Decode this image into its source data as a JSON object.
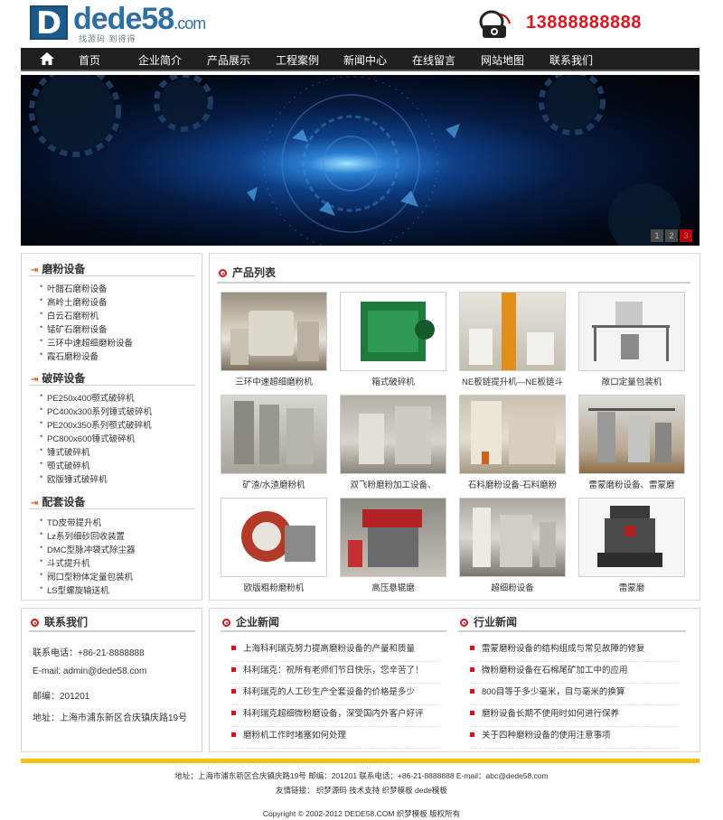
{
  "header": {
    "logo_text": "dede58",
    "logo_suffix": ".com",
    "logo_slogan": "找源码 到得得",
    "phone": "13888888888"
  },
  "nav": [
    "首页",
    "企业简介",
    "产品展示",
    "工程案例",
    "新闻中心",
    "在线留言",
    "网站地图",
    "联系我们"
  ],
  "slider": {
    "pages": [
      "1",
      "2",
      "3"
    ],
    "active": 3
  },
  "categories": [
    {
      "title": "磨粉设备",
      "items": [
        "叶腊石磨粉设备",
        "高岭土磨粉设备",
        "白云石磨粉机",
        "锰矿石磨粉设备",
        "三环中速超细磨粉设备",
        "霞石磨粉设备"
      ]
    },
    {
      "title": "破碎设备",
      "items": [
        "PE250x400颚式破碎机",
        "PC400x300系列锤式破碎机",
        "PE200x350系列颚式破碎机",
        "PC800x600锤式破碎机",
        "锤式破碎机",
        "颚式破碎机",
        "欧版锤式破碎机"
      ]
    },
    {
      "title": "配套设备",
      "items": [
        "TD皮带提升机",
        "Lz系列细砂回收装置",
        "DMC型脉冲袋式除尘器",
        "斗式提升机",
        "阀口型粉体定量包装机",
        "LS型螺旋输送机"
      ]
    }
  ],
  "products": {
    "title": "产品列表",
    "items": [
      "三环中速超细磨粉机",
      "箱式破碎机",
      "NE板链提升机—NE板链斗",
      "敞口定量包装机",
      "矿渣/水渣磨粉机",
      "双飞粉磨粉加工设备、",
      "石料磨粉设备-石料磨粉",
      "雷蒙磨粉设备、雷蒙磨",
      "欧版粗粉磨粉机",
      "高压悬辊磨",
      "超细粉设备",
      "雷蒙磨"
    ]
  },
  "contact": {
    "title": "联系我们",
    "phone": "联系电话：+86-21-8888888",
    "email": "E-mail: admin@dede58.com",
    "zip": "邮编：201201",
    "address": "地址：上海市浦东新区合庆镇庆路19号"
  },
  "company_news": {
    "title": "企业新闻",
    "items": [
      "上海科利瑞克努力提高磨粉设备的产量和质量",
      "科利瑞克：祝所有老师们节日快乐，您辛苦了！",
      "科利瑞克的人工砂生产全套设备的价格是多少",
      "科利瑞克超细微粉磨设备，深受国内外客户好评",
      "磨粉机工作时堵塞如何处理"
    ]
  },
  "industry_news": {
    "title": "行业新闻",
    "items": [
      "雷蒙磨粉设备的结构组成与常见故障的修复",
      "微粉磨粉设备在石棉尾矿加工中的应用",
      "800目等于多少毫米，目与毫米的换算",
      "磨粉设备长期不使用时如何进行保养",
      "关于四种磨粉设备的使用注意事项"
    ]
  },
  "footer": {
    "address": "地址：上海市浦东新区合庆镇庆路19号 邮编：201201 联系电话：+86-21-8888888 E-mail：abc@dede58.com",
    "links": "友情链接： 织梦源码 技术支持 织梦模板 dede模板",
    "copyright": "Copyright © 2002-2012 DEDE58.COM 织梦模板 版权所有"
  },
  "colors": {
    "accent": "#d2151b",
    "phone": "#e0141c",
    "nav_bg": "#202020",
    "footer_bar": "#f0c10e",
    "brand": "#2d6ea3"
  }
}
